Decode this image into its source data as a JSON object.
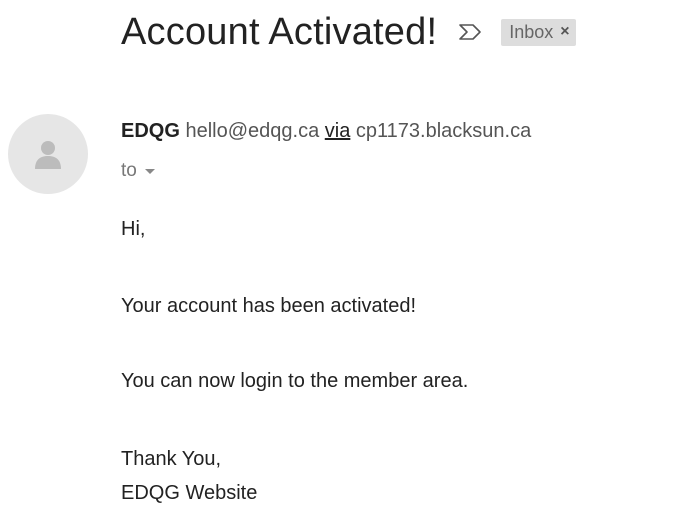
{
  "email": {
    "subject": "Account Activated!",
    "label": "Inbox",
    "label_remove": "×",
    "sender": {
      "name": "EDQG",
      "email": "hello@edqg.ca",
      "via_word": "via",
      "via_host": "cp1173.blacksun.ca"
    },
    "to_label": "to",
    "body": {
      "greeting": "Hi,",
      "line1": "Your account has been activated!",
      "line2": "You can now login to the member area.",
      "closing": "Thank You,",
      "signature": "EDQG Website"
    }
  },
  "icons": {
    "importance": "importance-marker-icon",
    "avatar": "person-silhouette-icon",
    "to_caret": "caret-down-icon"
  },
  "colors": {
    "text": "#222222",
    "muted": "#555555",
    "chip_bg": "#dddddd",
    "avatar_bg": "#e6e6e6"
  }
}
